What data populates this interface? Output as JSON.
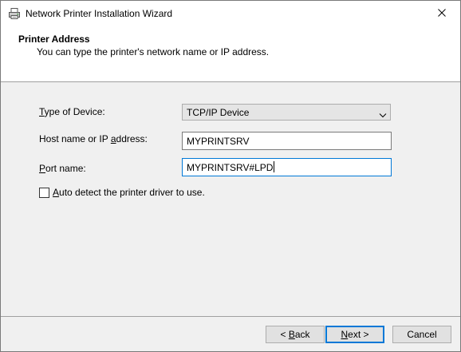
{
  "window": {
    "title": "Network Printer Installation Wizard"
  },
  "header": {
    "title": "Printer Address",
    "subtitle": "You can type the printer's network name or IP address."
  },
  "form": {
    "device_type": {
      "label_mnemonic": "T",
      "label_rest": "ype of Device:",
      "value": "TCP/IP Device"
    },
    "host": {
      "label_before": "Host name or IP ",
      "label_mnemonic": "a",
      "label_after": "ddress:",
      "value": "MYPRINTSRV"
    },
    "port": {
      "label_mnemonic": "P",
      "label_rest": "ort name:",
      "value": "MYPRINTSRV#LPD"
    },
    "auto_detect": {
      "checked": false,
      "label_mnemonic": "A",
      "label_rest": "uto detect the printer driver to use."
    }
  },
  "buttons": {
    "back": {
      "prefix": "< ",
      "mnemonic": "B",
      "rest": "ack"
    },
    "next": {
      "mnemonic": "N",
      "rest": "ext >"
    },
    "cancel": {
      "label": "Cancel"
    }
  },
  "colors": {
    "focus_accent": "#0078d7",
    "dialog_background": "#f0f0f0",
    "header_background": "#ffffff"
  },
  "icons": {
    "title": "printer-icon",
    "close": "close-icon",
    "combo": "chevron-down-icon"
  }
}
